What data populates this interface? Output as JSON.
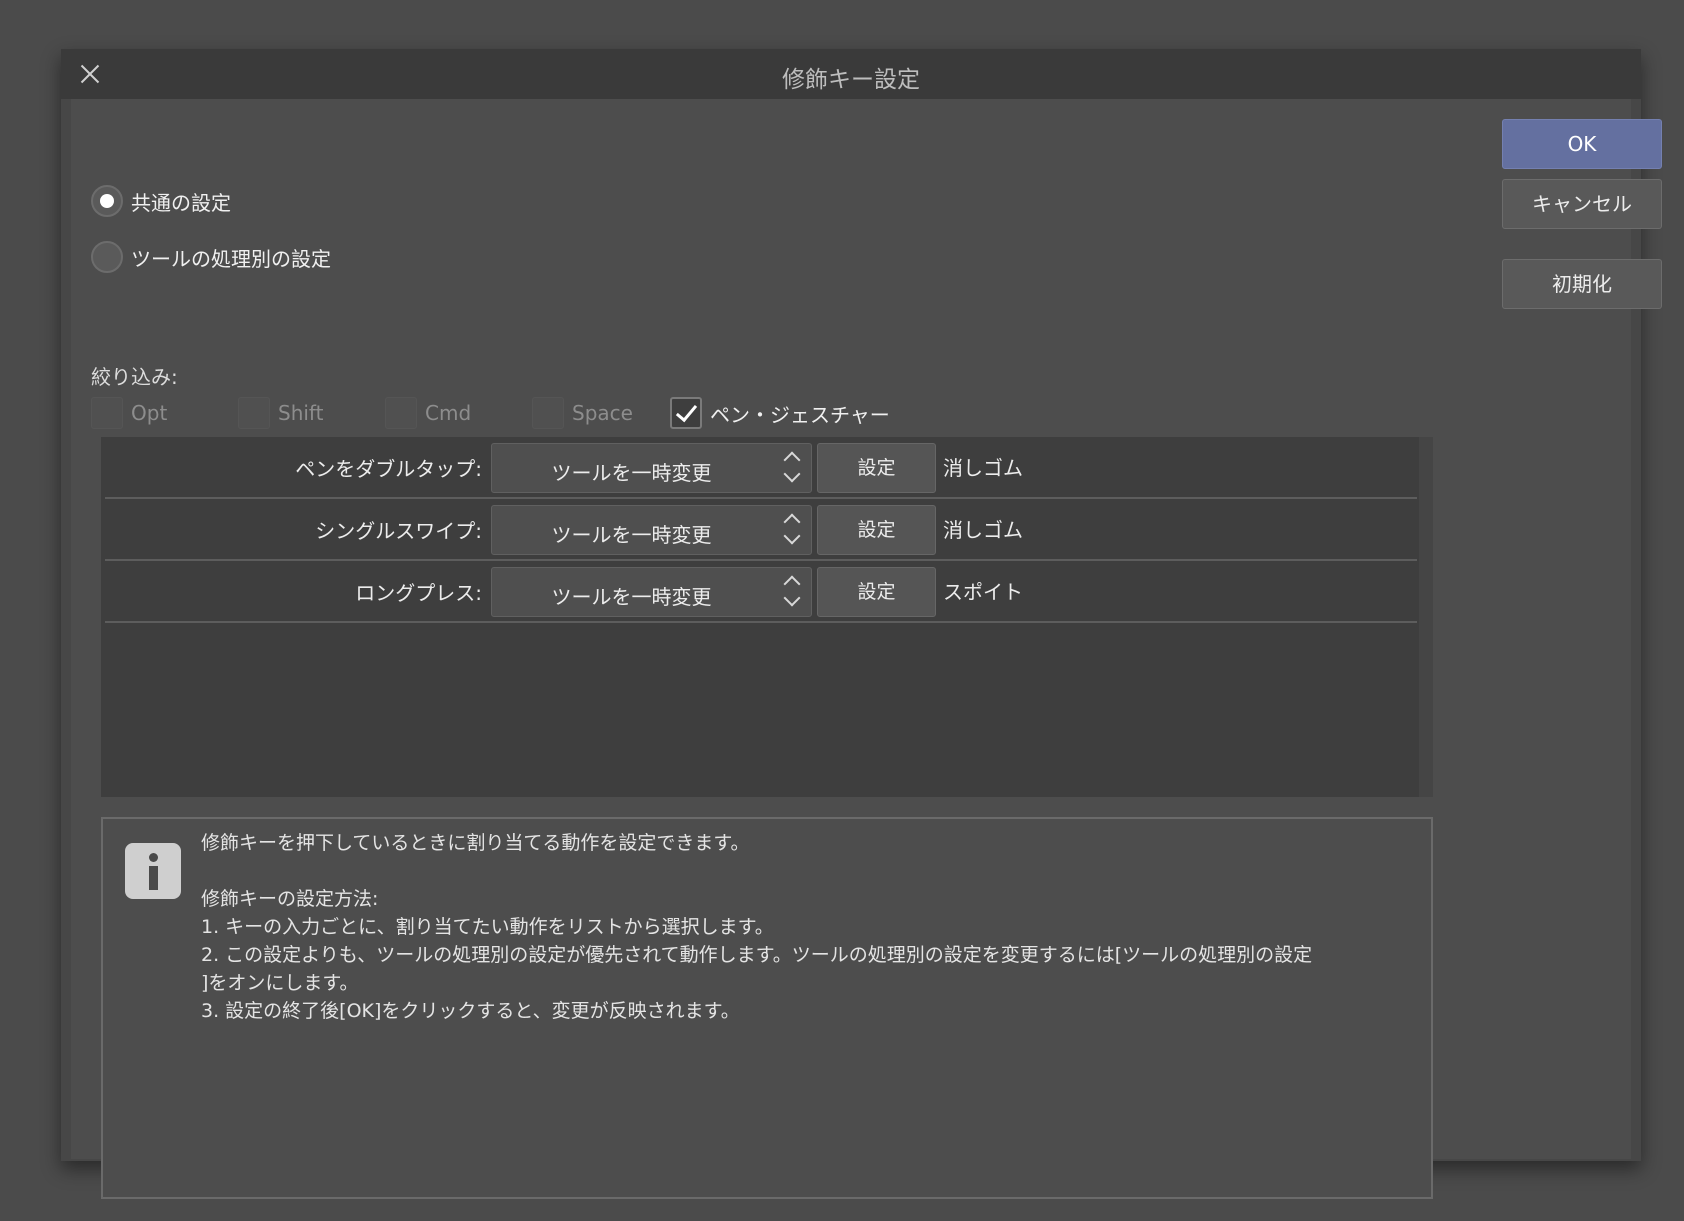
{
  "dialog": {
    "title": "修飾キー設定",
    "close_icon": "close-icon"
  },
  "mode": {
    "common": "共通の設定",
    "per_tool": "ツールの処理別の設定",
    "selected": "common"
  },
  "filter": {
    "label": "絞り込み:",
    "options": [
      {
        "label": "Opt",
        "checked": false
      },
      {
        "label": "Shift",
        "checked": false
      },
      {
        "label": "Cmd",
        "checked": false
      },
      {
        "label": "Space",
        "checked": false
      },
      {
        "label": "ペン・ジェスチャー",
        "checked": true
      }
    ]
  },
  "gestures": [
    {
      "label": "ペンをダブルタップ:",
      "action": "ツールを一時変更",
      "button": "設定",
      "value": "消しゴム"
    },
    {
      "label": "シングルスワイプ:",
      "action": "ツールを一時変更",
      "button": "設定",
      "value": "消しゴム"
    },
    {
      "label": "ロングプレス:",
      "action": "ツールを一時変更",
      "button": "設定",
      "value": "スポイト"
    }
  ],
  "info": {
    "icon": "info-icon",
    "line1": "修飾キーを押下しているときに割り当てる動作を設定できます。",
    "line2": "修飾キーの設定方法:",
    "line3": "1. キーの入力ごとに、割り当てたい動作をリストから選択します。",
    "line4": "2. この設定よりも、ツールの処理別の設定が優先されて動作します。ツールの処理別の設定を変更するには[ツールの処理別の設定",
    "line5": "]をオンにします。",
    "line6": "3. 設定の終了後[OK]をクリックすると、変更が反映されます。"
  },
  "buttons": {
    "ok": "OK",
    "cancel": "キャンセル",
    "reset": "初期化"
  },
  "colors": {
    "primary_button": "#6470a0",
    "background": "#4d4d4d"
  }
}
